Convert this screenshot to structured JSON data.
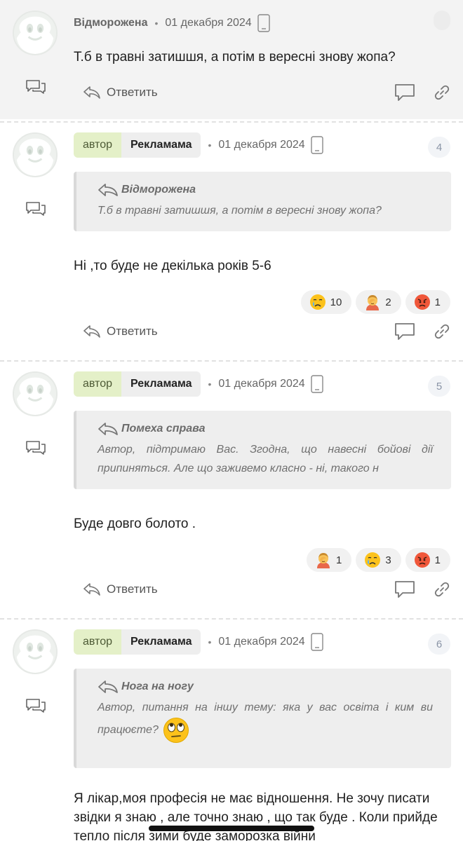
{
  "common": {
    "reply_label": "Ответить",
    "author_badge": "автор"
  },
  "comments": [
    {
      "author": "Відморожена",
      "date": "01 декабря 2024",
      "text": "Т.б в травні затишшя, а потім в вересні знову жопа?"
    },
    {
      "author": "Рекламама",
      "date": "01 декабря 2024",
      "number": "4",
      "quote_author": "Відморожена",
      "quote_text": "Т.б в травні затишшя, а потім в вересні знову жопа?",
      "text": "Ні ,то буде не декілька років 5-6",
      "reactions": [
        {
          "emoji": "crying-face",
          "count": "10"
        },
        {
          "emoji": "face-palm",
          "count": "2"
        },
        {
          "emoji": "angry-face",
          "count": "1"
        }
      ]
    },
    {
      "author": "Рекламама",
      "date": "01 декабря 2024",
      "number": "5",
      "quote_author": "Помеха справа",
      "quote_text": "Автор, підтримаю Вас. Згодна, що навесні бойові дії припиняться. Але що заживемо класно - ні, такого н",
      "text": "Буде довго болото .",
      "reactions": [
        {
          "emoji": "face-palm",
          "count": "1"
        },
        {
          "emoji": "crying-face",
          "count": "3"
        },
        {
          "emoji": "angry-face",
          "count": "1"
        }
      ]
    },
    {
      "author": "Рекламама",
      "date": "01 декабря 2024",
      "number": "6",
      "quote_author": "Нога на ногу",
      "quote_text": "Автор, питання на іншу тему: яка у вас освіта і ким ви працюєте?",
      "quote_emoji": "eye-roll-emoji",
      "text": "Я лікар,моя професія не має відношення. Не зочу писати звідки я знаю , але точно знаю , що так буде . Коли прийде тепло після зими буде заморозка війни"
    }
  ],
  "colors": {
    "author_badge_bg": "#e4f0c8",
    "nick_bg": "#eeeeee",
    "highlight_bg": "#f3f3f3",
    "quote_bg": "#eeeeee"
  }
}
